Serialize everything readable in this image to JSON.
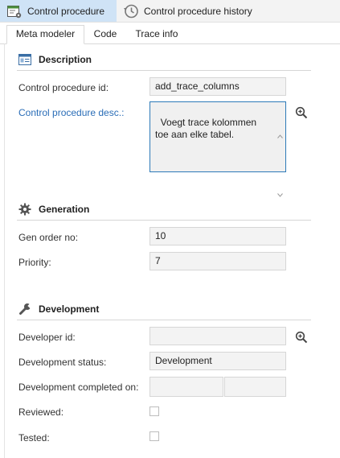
{
  "top_tabs": {
    "control_procedure": "Control procedure",
    "history": "Control procedure history"
  },
  "sub_tabs": {
    "meta_modeler": "Meta modeler",
    "code": "Code",
    "trace_info": "Trace info"
  },
  "description": {
    "title": "Description",
    "id_label": "Control procedure id:",
    "id_value": "add_trace_columns",
    "desc_label": "Control procedure desc.:",
    "desc_value": "Voegt trace kolommen toe aan elke tabel."
  },
  "generation": {
    "title": "Generation",
    "gen_order_label": "Gen order no:",
    "gen_order_value": "10",
    "priority_label": "Priority:",
    "priority_value": "7"
  },
  "development": {
    "title": "Development",
    "developer_label": "Developer id:",
    "developer_value": "",
    "status_label": "Development status:",
    "status_value": "Development",
    "completed_label": "Development completed on:",
    "reviewed_label": "Reviewed:",
    "tested_label": "Tested:"
  },
  "colors": {
    "active_tab": "#cfe3f6",
    "link_label": "#2a6db7",
    "textarea_border": "#2d7ab8"
  }
}
